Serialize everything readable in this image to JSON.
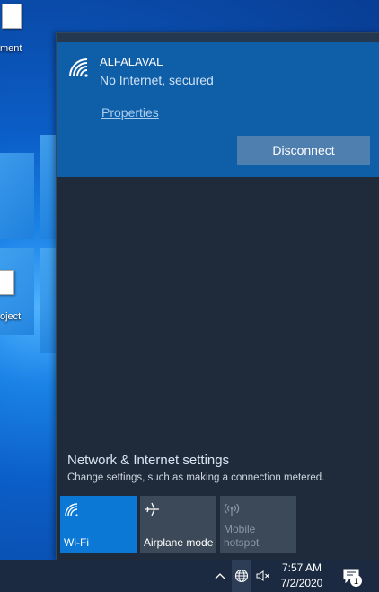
{
  "desktop": {
    "icon1_label": "ment",
    "icon2_label": "oject"
  },
  "network": {
    "name": "ALFALAVAL",
    "status": "No Internet, secured",
    "properties_label": "Properties",
    "disconnect_label": "Disconnect"
  },
  "settings": {
    "title": "Network & Internet settings",
    "description": "Change settings, such as making a connection metered."
  },
  "quick_actions": [
    {
      "label": "Wi-Fi",
      "icon": "wifi-icon",
      "active": true
    },
    {
      "label": "Airplane mode",
      "icon": "airplane-icon",
      "active": false
    },
    {
      "label": "Mobile\nhotspot",
      "icon": "hotspot-icon",
      "active": false,
      "disabled": true
    }
  ],
  "taskbar": {
    "time": "7:57 AM",
    "date": "7/2/2020",
    "notification_count": "1"
  },
  "colors": {
    "accent": "#0a78d4",
    "card": "#0f5ea8",
    "flyout_bg": "#1f2b3a",
    "taskbar": "#1b2a40"
  }
}
